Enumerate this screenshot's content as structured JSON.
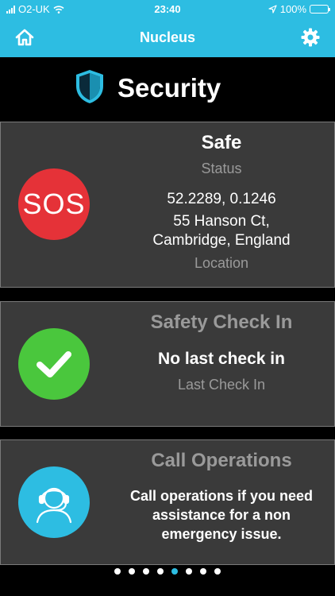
{
  "status_bar": {
    "carrier": "O2-UK",
    "time": "23:40",
    "battery": "100%"
  },
  "nav": {
    "title": "Nucleus",
    "home_icon": "home-icon",
    "settings_icon": "gear-icon"
  },
  "header": {
    "title": "Security",
    "icon": "shield-icon"
  },
  "sos_card": {
    "button_label": "SOS",
    "status_value": "Safe",
    "status_label": "Status",
    "coordinates": "52.2289, 0.1246",
    "address_line1": "55 Hanson Ct,",
    "address_line2": "Cambridge, England",
    "location_label": "Location",
    "color": "#e53238"
  },
  "checkin_card": {
    "title": "Safety Check In",
    "value": "No last check in",
    "label": "Last Check In",
    "icon": "checkmark-icon",
    "color": "#4ac73d"
  },
  "ops_card": {
    "title": "Call Operations",
    "line1": "Call operations if you need",
    "line2": "assistance for a non",
    "line3": "emergency issue.",
    "icon": "operator-headset-icon",
    "color": "#2dbde2"
  },
  "pagination": {
    "total": 8,
    "active_index": 4
  },
  "colors": {
    "accent": "#2dbde2",
    "card_bg": "#3a3a3a"
  }
}
